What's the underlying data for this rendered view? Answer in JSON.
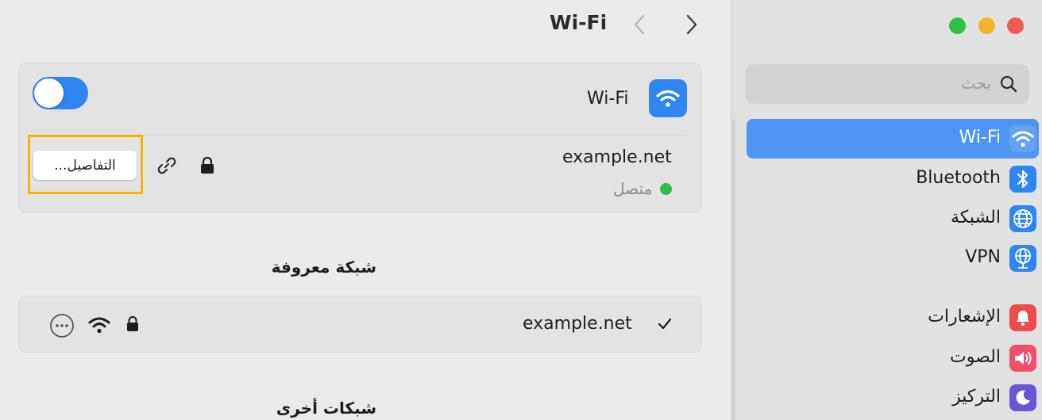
{
  "window": {
    "title": "Wi-Fi"
  },
  "wifi_card": {
    "toggle_on": true,
    "label": "Wi-Fi",
    "connected_network": "example.net",
    "status": "متصل",
    "details_button": "التفاصيل..."
  },
  "known_networks": {
    "title": "شبكة معروفة",
    "items": [
      {
        "name": "example.net"
      }
    ]
  },
  "other_networks": {
    "title": "شبكات أخرى"
  },
  "sidebar": {
    "search_placeholder": "بحث",
    "items": [
      {
        "label": "Wi-Fi",
        "icon": "wifi-icon",
        "color": "#2f86f0",
        "active": true
      },
      {
        "label": "Bluetooth",
        "icon": "bluetooth-icon",
        "color": "#2f86f0"
      },
      {
        "label": "الشبكة",
        "icon": "globe-icon",
        "color": "#2f86f0"
      },
      {
        "label": "VPN",
        "icon": "vpn-globe-icon",
        "color": "#2f86f0"
      },
      {
        "label": "الإشعارات",
        "icon": "bell-icon",
        "color": "#ef4b4b"
      },
      {
        "label": "الصوت",
        "icon": "speaker-icon",
        "color": "#ee4f6b"
      },
      {
        "label": "التركيز",
        "icon": "moon-icon",
        "color": "#6757d6"
      }
    ]
  },
  "colors": {
    "accent": "#2f86f0",
    "highlight": "#f5b400",
    "connected": "#30c04a"
  }
}
